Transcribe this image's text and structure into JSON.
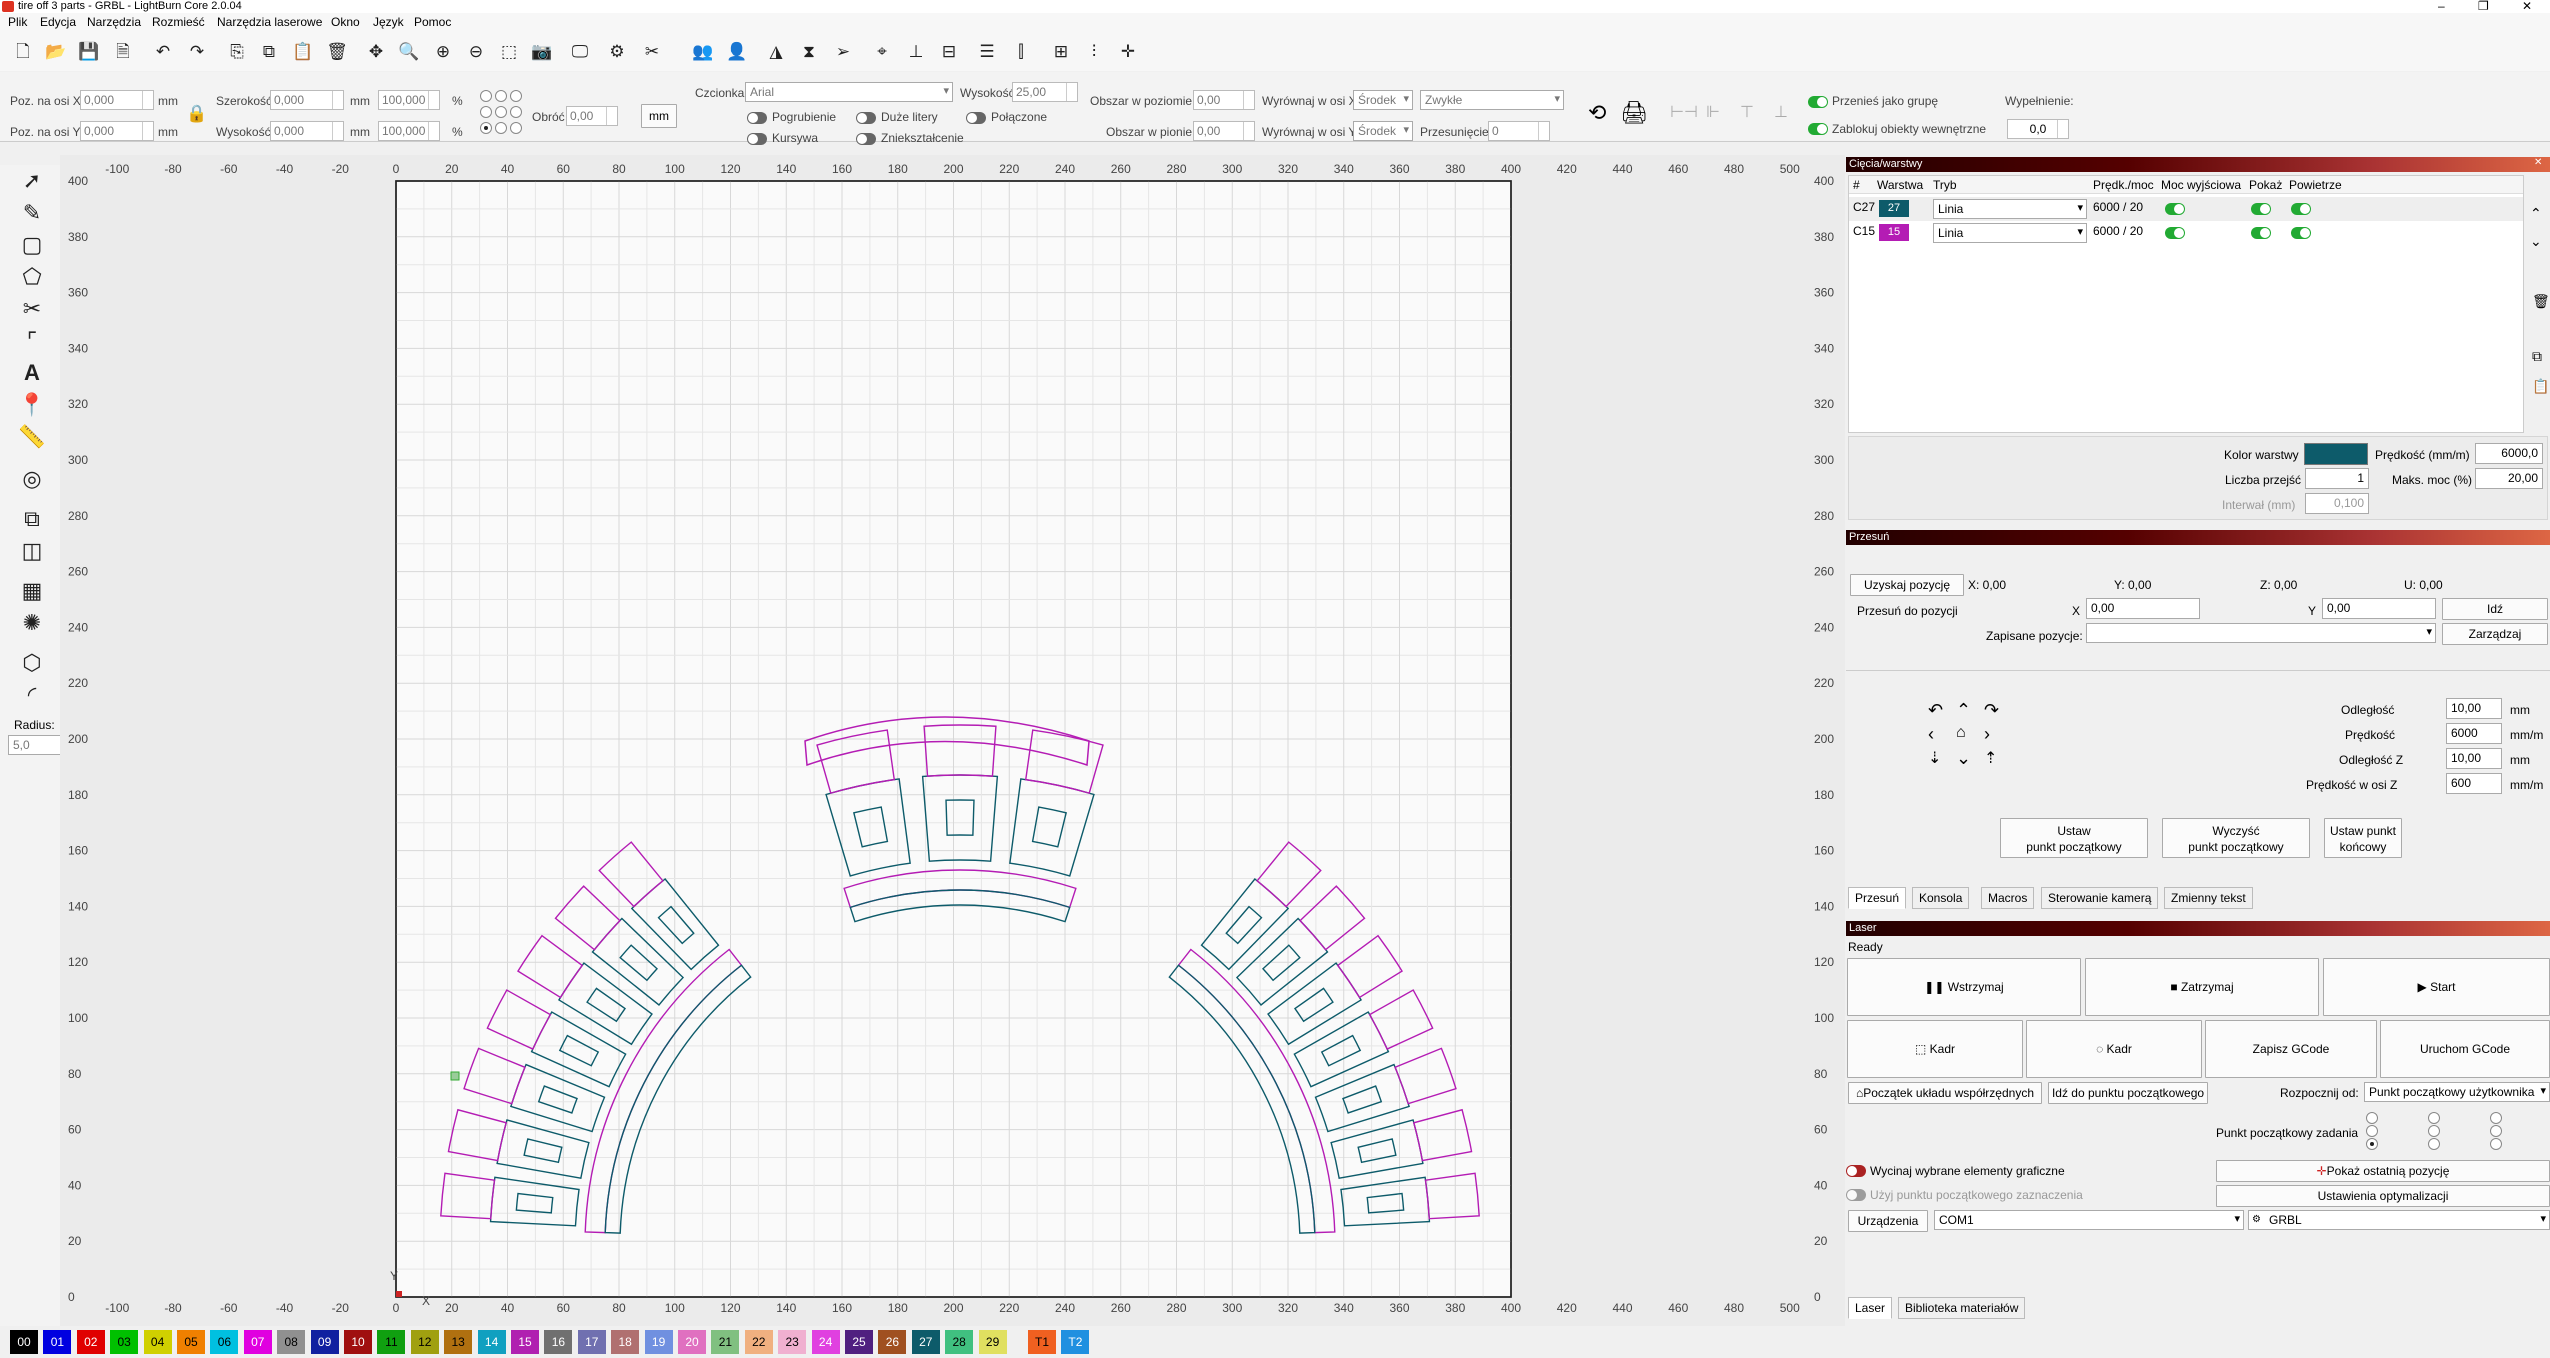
{
  "app": {
    "title": "tire off 3 parts - GRBL - LightBurn Core 2.0.04"
  },
  "menu": [
    "Plik",
    "Edycja",
    "Narzędzia",
    "Rozmieść",
    "Narzędzia laserowe",
    "Okno",
    "Język",
    "Pomoc"
  ],
  "props": {
    "pos_x_label": "Poz. na osi X",
    "pos_x": "0,000",
    "pos_y_label": "Poz. na osi Y",
    "pos_y": "0,000",
    "mm1": "mm",
    "mm2": "mm",
    "width_label": "Szerokość",
    "width": "0,000",
    "height_label": "Wysokość",
    "height": "0,000",
    "mm3": "mm",
    "mm4": "mm",
    "scale_w": "100,000",
    "scale_h": "100,000",
    "pct1": "%",
    "pct2": "%",
    "rotate_label": "Obróć",
    "rotate": "0,00",
    "unit_button": "mm",
    "font_label": "Czcionka",
    "font": "Arial",
    "font_height_label": "Wysokość",
    "font_height": "25,00",
    "bold": "Pogrubienie",
    "italic": "Kursywa",
    "caps": "Duże litery",
    "squeeze": "Zniekształcenie",
    "welded": "Połączone",
    "hspace_label": "Obszar w poziomie",
    "hspace": "0,00",
    "vspace_label": "Obszar w pionie",
    "vspace": "0,00",
    "alignx_label": "Wyrównaj w osi X",
    "alignx": "Środek",
    "aligny_label": "Wyrównaj w osi Y",
    "aligny": "Środek",
    "style": "Zwykłe",
    "offset_label": "Przesunięcie",
    "offset": "0",
    "move_group": "Przenieś jako grupę",
    "lock_inner": "Zablokuj obiekty wewnętrzne",
    "fill_label": "Wypełnienie:",
    "fill": "0,0"
  },
  "left_tools": {
    "radius_label": "Radius:",
    "radius": "5,0"
  },
  "ruler": {
    "top": [
      "-100",
      "-80",
      "-60",
      "-40",
      "-20",
      "0",
      "20",
      "40",
      "60",
      "80",
      "100",
      "120",
      "140",
      "160",
      "180",
      "200",
      "220",
      "240",
      "260",
      "280",
      "300",
      "320",
      "340",
      "360",
      "380",
      "400",
      "420",
      "440",
      "460",
      "480",
      "500"
    ],
    "left": [
      "400",
      "380",
      "360",
      "340",
      "320",
      "300",
      "280",
      "260",
      "240",
      "220",
      "200",
      "180",
      "160",
      "140",
      "120",
      "100",
      "80",
      "60",
      "40",
      "20",
      "0"
    ],
    "right": [
      "400",
      "380",
      "360",
      "340",
      "320",
      "300",
      "280",
      "260",
      "240",
      "220",
      "200",
      "180",
      "160",
      "140",
      "120",
      "100",
      "80",
      "60",
      "40",
      "20",
      "0"
    ],
    "bottom": [
      "-100",
      "-80",
      "-60",
      "-40",
      "-20",
      "0",
      "20",
      "40",
      "60",
      "80",
      "100",
      "120",
      "140",
      "160",
      "180",
      "200",
      "220",
      "240",
      "260",
      "280",
      "300",
      "320",
      "340",
      "360",
      "380",
      "400",
      "420",
      "440",
      "460",
      "480",
      "500"
    ],
    "x_marker": "X",
    "y_marker": "Y"
  },
  "cuts": {
    "header": "Cięcia/warstwy",
    "columns": [
      "#",
      "Warstwa",
      "Tryb",
      "Prędk./moc",
      "Moc wyjściowa",
      "Pokaż",
      "Powietrze"
    ],
    "rows": [
      {
        "id": "C27",
        "layer": "27",
        "color": "#0d5b6a",
        "mode": "Linia",
        "speed_power": "6000 / 20"
      },
      {
        "id": "C15",
        "layer": "15",
        "color": "#b41cb4",
        "mode": "Linia",
        "speed_power": "6000 / 20"
      }
    ],
    "layer_color_label": "Kolor warstwy",
    "layer_color": "#0d5b6a",
    "speed_label": "Prędkość (mm/m)",
    "speed": "6000,0",
    "passes_label": "Liczba przejść",
    "passes": "1",
    "max_power_label": "Maks. moc (%)",
    "max_power": "20,00",
    "interval_label": "Interwał (mm)",
    "interval": "0,100"
  },
  "move": {
    "header": "Przesuń",
    "get_position": "Uzyskaj pozycję",
    "x_pos": "X: 0,00",
    "y_pos": "Y: 0,00",
    "z_pos": "Z: 0,00",
    "u_pos": "U: 0,00",
    "move_to_label": "Przesuń do pozycji",
    "x_label": "X",
    "x_value": "0,00",
    "y_label": "Y",
    "y_value": "0,00",
    "go_button": "Idź",
    "saved_label": "Zapisane pozycje:",
    "manage_button": "Zarządzaj",
    "distance_label": "Odległość",
    "distance": "10,00",
    "distance_unit": "mm",
    "speed_label": "Prędkość",
    "speed": "6000",
    "speed_unit": "mm/m",
    "z_distance_label": "Odległość Z",
    "z_distance": "10,00",
    "z_distance_unit": "mm",
    "z_speed_label": "Prędkość w osi Z",
    "z_speed": "600",
    "z_speed_unit": "mm/m",
    "set_origin": "Ustaw\npunkt początkowy",
    "clear_origin": "Wyczyść\npunkt początkowy",
    "set_finish": "Ustaw punkt\nkońcowy"
  },
  "mid_tabs": [
    "Przesuń",
    "Konsola",
    "Macros",
    "Sterowanie kamerą",
    "Zmienny tekst"
  ],
  "laser": {
    "header": "Laser",
    "status": "Ready",
    "pause": "Wstrzymaj",
    "stop": "Zatrzymaj",
    "start": "Start",
    "frame1": "Kadr",
    "frame2": "Kadr",
    "save_gcode": "Zapisz GCode",
    "run_gcode": "Uruchom GCode",
    "home_coords": "Początek układu współrzędnych",
    "go_origin": "Idź do punktu początkowego",
    "start_from_label": "Rozpocznij od:",
    "start_from": "Punkt początkowy użytkownika",
    "job_origin_label": "Punkt początkowy zadania",
    "cut_selected": "Wycinaj wybrane elementy graficzne",
    "use_selection_origin": "Użyj punktu początkowego zaznaczenia",
    "show_last_position": "Pokaż ostatnią pozycję",
    "optimization_settings": "Ustawienia optymalizacji",
    "devices_button": "Urządzenia",
    "port": "COM1",
    "device": "GRBL"
  },
  "bottom_tabs": [
    "Laser",
    "Biblioteka materiałów"
  ],
  "palette": [
    {
      "label": "00",
      "color": "#000000",
      "fg": "#fff"
    },
    {
      "label": "01",
      "color": "#0000e0",
      "fg": "#fff"
    },
    {
      "label": "02",
      "color": "#e00000",
      "fg": "#fff"
    },
    {
      "label": "03",
      "color": "#00c000",
      "fg": "#000"
    },
    {
      "label": "04",
      "color": "#d0d000",
      "fg": "#000"
    },
    {
      "label": "05",
      "color": "#f08000",
      "fg": "#000"
    },
    {
      "label": "06",
      "color": "#00c0e0",
      "fg": "#000"
    },
    {
      "label": "07",
      "color": "#e000e0",
      "fg": "#fff"
    },
    {
      "label": "08",
      "color": "#909090",
      "fg": "#000"
    },
    {
      "label": "09",
      "color": "#1020a0",
      "fg": "#fff"
    },
    {
      "label": "10",
      "color": "#a01010",
      "fg": "#fff"
    },
    {
      "label": "11",
      "color": "#10a010",
      "fg": "#000"
    },
    {
      "label": "12",
      "color": "#a0a010",
      "fg": "#000"
    },
    {
      "label": "13",
      "color": "#b07010",
      "fg": "#000"
    },
    {
      "label": "14",
      "color": "#10a0c0",
      "fg": "#fff"
    },
    {
      "label": "15",
      "color": "#b020b0",
      "fg": "#fff"
    },
    {
      "label": "16",
      "color": "#707070",
      "fg": "#fff"
    },
    {
      "label": "17",
      "color": "#7070b0",
      "fg": "#fff"
    },
    {
      "label": "18",
      "color": "#b07070",
      "fg": "#fff"
    },
    {
      "label": "19",
      "color": "#7090e0",
      "fg": "#fff"
    },
    {
      "label": "20",
      "color": "#e070c0",
      "fg": "#fff"
    },
    {
      "label": "21",
      "color": "#80c080",
      "fg": "#000"
    },
    {
      "label": "22",
      "color": "#f0b080",
      "fg": "#000"
    },
    {
      "label": "23",
      "color": "#f0b0d0",
      "fg": "#000"
    },
    {
      "label": "24",
      "color": "#e040e0",
      "fg": "#fff"
    },
    {
      "label": "25",
      "color": "#502080",
      "fg": "#fff"
    },
    {
      "label": "26",
      "color": "#a05020",
      "fg": "#fff"
    },
    {
      "label": "27",
      "color": "#0d5b6a",
      "fg": "#fff"
    },
    {
      "label": "28",
      "color": "#40c080",
      "fg": "#000"
    },
    {
      "label": "29",
      "color": "#e0e060",
      "fg": "#000"
    },
    {
      "label": "T1",
      "color": "#f06020",
      "fg": "#000"
    },
    {
      "label": "T2",
      "color": "#2090e0",
      "fg": "#fff"
    }
  ]
}
